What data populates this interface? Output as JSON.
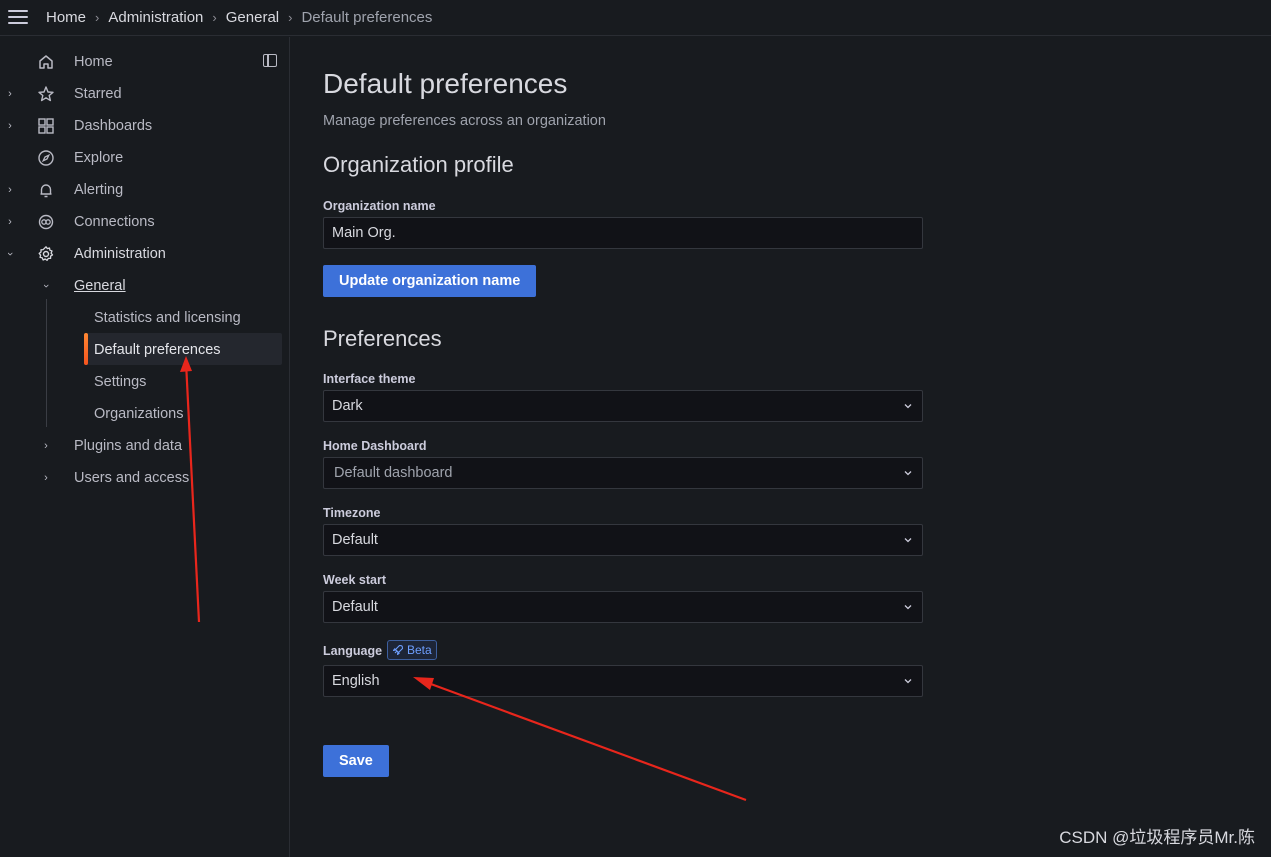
{
  "colors": {
    "accent": "#3d71d9",
    "active_bar": "#f5541e",
    "background": "#181b1f",
    "annotation": "#e8261c"
  },
  "breadcrumb": {
    "items": [
      "Home",
      "Administration",
      "General"
    ],
    "current": "Default preferences"
  },
  "sidebar": {
    "items": [
      {
        "label": "Home",
        "icon": "home-icon"
      },
      {
        "label": "Starred",
        "icon": "star-icon"
      },
      {
        "label": "Dashboards",
        "icon": "dashboards-icon"
      },
      {
        "label": "Explore",
        "icon": "compass-icon"
      },
      {
        "label": "Alerting",
        "icon": "bell-icon"
      },
      {
        "label": "Connections",
        "icon": "connections-icon"
      },
      {
        "label": "Administration",
        "icon": "gear-icon"
      }
    ],
    "sub": {
      "general": "General",
      "children": [
        "Statistics and licensing",
        "Default preferences",
        "Settings",
        "Organizations"
      ],
      "plugins": "Plugins and data",
      "users": "Users and access"
    }
  },
  "page": {
    "title": "Default preferences",
    "subtitle": "Manage preferences across an organization"
  },
  "org_profile": {
    "heading": "Organization profile",
    "name_label": "Organization name",
    "name_value": "Main Org.",
    "update_button": "Update organization name"
  },
  "preferences": {
    "heading": "Preferences",
    "theme_label": "Interface theme",
    "theme_value": "Dark",
    "home_label": "Home Dashboard",
    "home_placeholder": "Default dashboard",
    "timezone_label": "Timezone",
    "timezone_value": "Default",
    "week_label": "Week start",
    "week_value": "Default",
    "language_label": "Language",
    "language_badge": "Beta",
    "language_value": "English",
    "save_button": "Save"
  },
  "watermark": "CSDN @垃圾程序员Mr.陈"
}
